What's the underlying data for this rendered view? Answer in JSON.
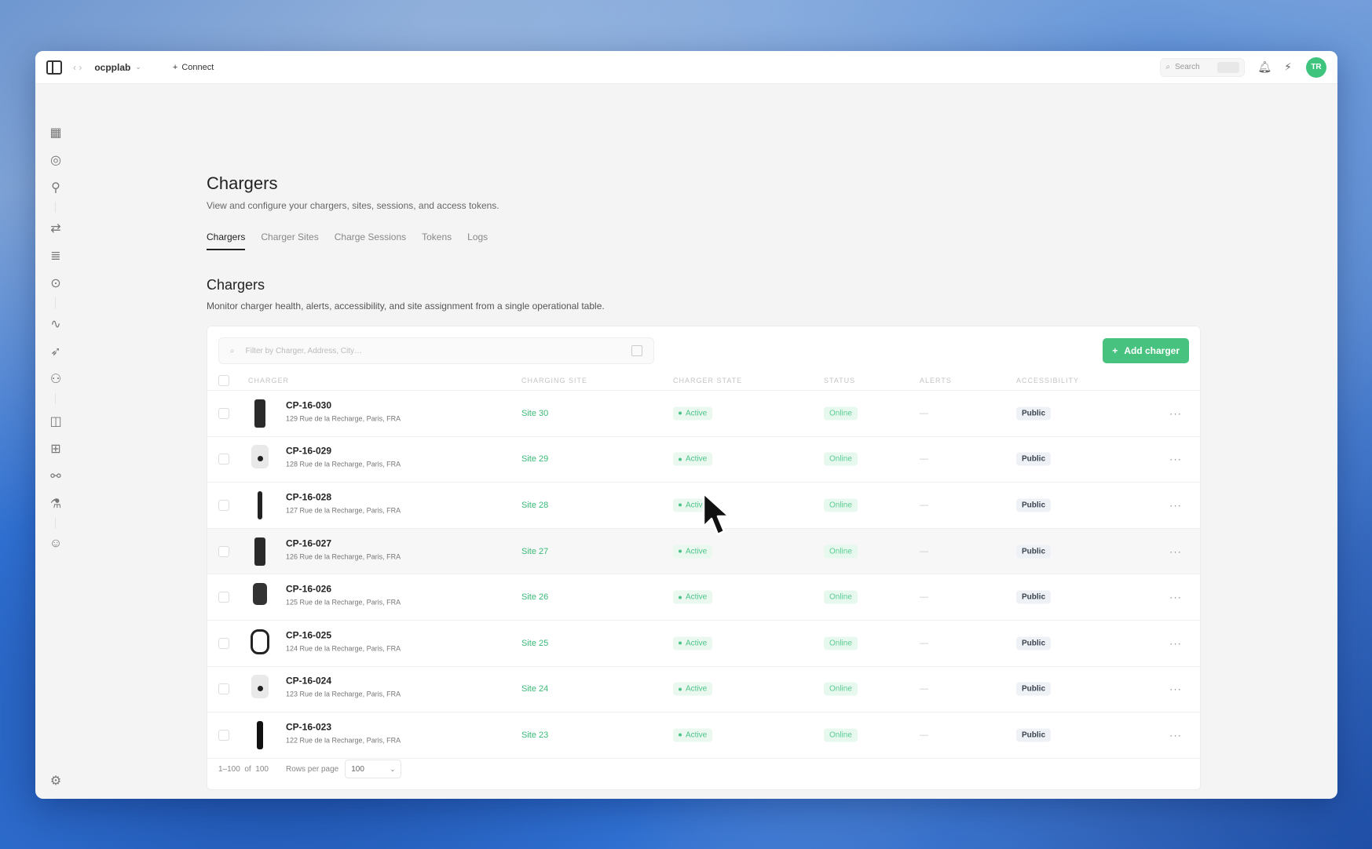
{
  "topbar": {
    "org_name": "ocpplab",
    "connect_label": "Connect",
    "search_placeholder": "Search",
    "avatar_initials": "TR"
  },
  "sidebar": {
    "icons": [
      "grid-icon",
      "map-pin-icon",
      "route-icon",
      "transfer-icon",
      "database-icon",
      "location-icon",
      "activity-icon",
      "rocket-icon",
      "network-icon",
      "layers-icon",
      "widgets-icon",
      "integration-icon",
      "flask-icon",
      "users-icon",
      "settings-icon"
    ]
  },
  "header": {
    "title": "Chargers",
    "subtitle": "View and configure your chargers, sites, sessions, and access tokens.",
    "tabs": [
      {
        "label": "Chargers",
        "active": true
      },
      {
        "label": "Charger Sites",
        "active": false
      },
      {
        "label": "Charge Sessions",
        "active": false
      },
      {
        "label": "Tokens",
        "active": false
      },
      {
        "label": "Logs",
        "active": false
      }
    ]
  },
  "section": {
    "title": "Chargers",
    "subtitle": "Monitor charger health, alerts, accessibility, and site assignment from a single operational table."
  },
  "toolbar": {
    "filter_placeholder": "Filter by Charger, Address, City…",
    "add_label": "Add charger"
  },
  "table": {
    "columns": [
      "CHARGER",
      "CHARGING SITE",
      "CHARGER STATE",
      "STATUS",
      "ALERTS",
      "ACCESSIBILITY"
    ],
    "rows": [
      {
        "id": "CP-16-030",
        "address": "129 Rue de la Recharge, Paris, FRA",
        "site": "Site 30",
        "state": "Active",
        "status": "Online",
        "alerts": "—",
        "access": "Public",
        "thumb": "t1"
      },
      {
        "id": "CP-16-029",
        "address": "128 Rue de la Recharge, Paris, FRA",
        "site": "Site 29",
        "state": "Active",
        "status": "Online",
        "alerts": "—",
        "access": "Public",
        "thumb": "t2"
      },
      {
        "id": "CP-16-028",
        "address": "127 Rue de la Recharge, Paris, FRA",
        "site": "Site 28",
        "state": "Active",
        "status": "Online",
        "alerts": "—",
        "access": "Public",
        "thumb": "t3"
      },
      {
        "id": "CP-16-027",
        "address": "126 Rue de la Recharge, Paris, FRA",
        "site": "Site 27",
        "state": "Active",
        "status": "Online",
        "alerts": "—",
        "access": "Public",
        "thumb": "t4"
      },
      {
        "id": "CP-16-026",
        "address": "125 Rue de la Recharge, Paris, FRA",
        "site": "Site 26",
        "state": "Active",
        "status": "Online",
        "alerts": "—",
        "access": "Public",
        "thumb": "t5"
      },
      {
        "id": "CP-16-025",
        "address": "124 Rue de la Recharge, Paris, FRA",
        "site": "Site 25",
        "state": "Active",
        "status": "Online",
        "alerts": "—",
        "access": "Public",
        "thumb": "t6"
      },
      {
        "id": "CP-16-024",
        "address": "123 Rue de la Recharge, Paris, FRA",
        "site": "Site 24",
        "state": "Active",
        "status": "Online",
        "alerts": "—",
        "access": "Public",
        "thumb": "t2"
      },
      {
        "id": "CP-16-023",
        "address": "122 Rue de la Recharge, Paris, FRA",
        "site": "Site 23",
        "state": "Active",
        "status": "Online",
        "alerts": "—",
        "access": "Public",
        "thumb": "t8"
      }
    ]
  },
  "footer": {
    "range": "1–100",
    "of_label": "of",
    "total": "100",
    "rows_per_page_label": "Rows per page",
    "rows_per_page_value": "100"
  },
  "colors": {
    "accent": "#47c27f",
    "link": "#3bb978"
  }
}
